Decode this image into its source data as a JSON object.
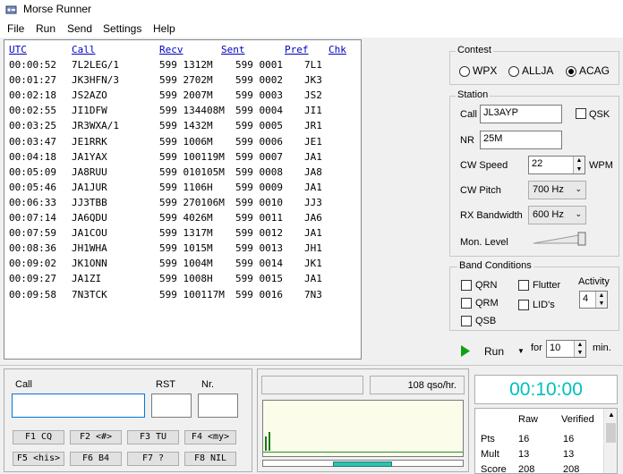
{
  "app": {
    "title": "Morse Runner"
  },
  "menu": [
    "File",
    "Run",
    "Send",
    "Settings",
    "Help"
  ],
  "log": {
    "headers": {
      "utc": "UTC",
      "call": "Call",
      "recv": "Recv",
      "sent": "Sent",
      "pref": "Pref",
      "chk": "Chk"
    },
    "rows": [
      {
        "utc": "00:00:52",
        "call": "7L2LEG/1",
        "recv": "599 1312M",
        "sent": "599 0001",
        "pref": "7L1"
      },
      {
        "utc": "00:01:27",
        "call": "JK3HFN/3",
        "recv": "599 2702M",
        "sent": "599 0002",
        "pref": "JK3"
      },
      {
        "utc": "00:02:18",
        "call": "JS2AZO",
        "recv": "599 2007M",
        "sent": "599 0003",
        "pref": "JS2"
      },
      {
        "utc": "00:02:55",
        "call": "JI1DFW",
        "recv": "599 134408M",
        "sent": "599 0004",
        "pref": "JI1"
      },
      {
        "utc": "00:03:25",
        "call": "JR3WXA/1",
        "recv": "599 1432M",
        "sent": "599 0005",
        "pref": "JR1"
      },
      {
        "utc": "00:03:47",
        "call": "JE1RRK",
        "recv": "599 1006M",
        "sent": "599 0006",
        "pref": "JE1"
      },
      {
        "utc": "00:04:18",
        "call": "JA1YAX",
        "recv": "599 100119M",
        "sent": "599 0007",
        "pref": "JA1"
      },
      {
        "utc": "00:05:09",
        "call": "JA8RUU",
        "recv": "599 010105M",
        "sent": "599 0008",
        "pref": "JA8"
      },
      {
        "utc": "00:05:46",
        "call": "JA1JUR",
        "recv": "599 1106H",
        "sent": "599 0009",
        "pref": "JA1"
      },
      {
        "utc": "00:06:33",
        "call": "JJ3TBB",
        "recv": "599 270106M",
        "sent": "599 0010",
        "pref": "JJ3"
      },
      {
        "utc": "00:07:14",
        "call": "JA6QDU",
        "recv": "599 4026M",
        "sent": "599 0011",
        "pref": "JA6"
      },
      {
        "utc": "00:07:59",
        "call": "JA1COU",
        "recv": "599 1317M",
        "sent": "599 0012",
        "pref": "JA1"
      },
      {
        "utc": "00:08:36",
        "call": "JH1WHA",
        "recv": "599 1015M",
        "sent": "599 0013",
        "pref": "JH1"
      },
      {
        "utc": "00:09:02",
        "call": "JK1ONN",
        "recv": "599 1004M",
        "sent": "599 0014",
        "pref": "JK1"
      },
      {
        "utc": "00:09:27",
        "call": "JA1ZI",
        "recv": "599 1008H",
        "sent": "599 0015",
        "pref": "JA1"
      },
      {
        "utc": "00:09:58",
        "call": "7N3TCK",
        "recv": "599 100117M",
        "sent": "599 0016",
        "pref": "7N3"
      }
    ]
  },
  "contest": {
    "legend": "Contest",
    "options": [
      {
        "label": "WPX",
        "selected": false
      },
      {
        "label": "ALLJA",
        "selected": false
      },
      {
        "label": "ACAG",
        "selected": true
      }
    ]
  },
  "station": {
    "legend": "Station",
    "call_label": "Call",
    "call_value": "JL3AYP",
    "qsk_label": "QSK",
    "nr_label": "NR",
    "nr_value": "25M",
    "cw_speed_label": "CW Speed",
    "cw_speed_value": "22",
    "wpm_label": "WPM",
    "cw_pitch_label": "CW Pitch",
    "cw_pitch_value": "700 Hz",
    "rx_bw_label": "RX Bandwidth",
    "rx_bw_value": "600 Hz",
    "mon_level_label": "Mon. Level"
  },
  "band": {
    "legend": "Band Conditions",
    "qrn": "QRN",
    "qrm": "QRM",
    "qsb": "QSB",
    "flutter": "Flutter",
    "lids": "LID's",
    "activity_label": "Activity",
    "activity_value": "4"
  },
  "run": {
    "label": "Run",
    "for_label": "for",
    "minutes": "10",
    "min_label": "min."
  },
  "entry": {
    "call_label": "Call",
    "rst_label": "RST",
    "nr_label": "Nr."
  },
  "fkeys": [
    "F1  CQ",
    "F2 <#>",
    "F3  TU",
    "F4 <my>",
    "F5 <his>",
    "F6  B4",
    "F7  ?",
    "F8  NIL"
  ],
  "rate": "108  qso/hr.",
  "clock": "00:10:00",
  "score": {
    "headers": [
      "Raw",
      "Verified"
    ],
    "rows": [
      {
        "label": "Pts",
        "raw": "16",
        "verified": "16"
      },
      {
        "label": "Mult",
        "raw": "13",
        "verified": "13"
      },
      {
        "label": "Score",
        "raw": "208",
        "verified": "208"
      }
    ]
  }
}
